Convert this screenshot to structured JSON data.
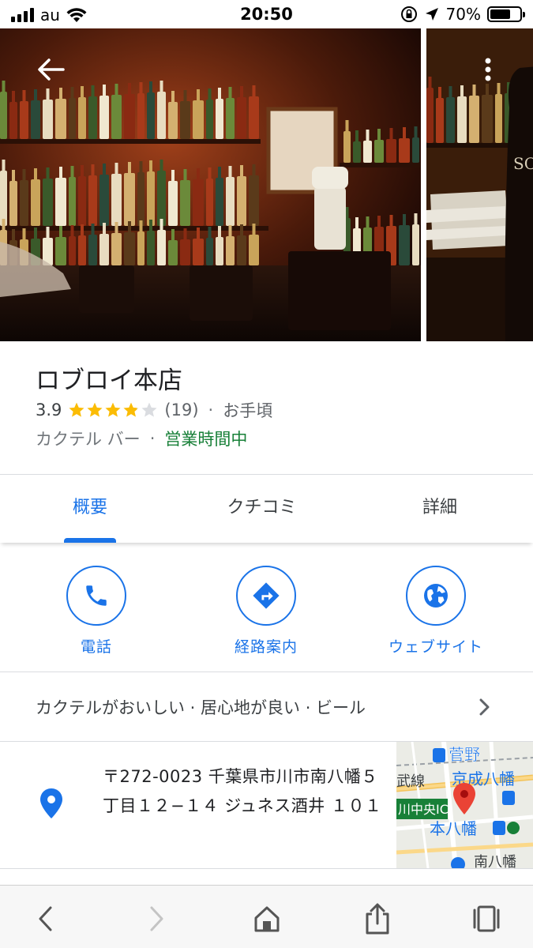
{
  "status_bar": {
    "carrier": "au",
    "time": "20:50",
    "battery": "70%",
    "battery_level": 0.7
  },
  "place": {
    "name": "ロブロイ本店",
    "rating": "3.9",
    "rating_value": 3.9,
    "review_count": "(19)",
    "separator": "·",
    "price_level": "お手頃",
    "category": "カクテル バー",
    "open_status": "営業時間中"
  },
  "tabs": [
    {
      "label": "概要",
      "active": true
    },
    {
      "label": "クチコミ",
      "active": false
    },
    {
      "label": "詳細",
      "active": false
    }
  ],
  "actions": {
    "call": "電話",
    "directions": "経路案内",
    "website": "ウェブサイト"
  },
  "highlights": "カクテルがおいしい · 居心地が良い · ビール",
  "address": "〒272-0023 千葉県市川市南八幡５丁目１２−１４ ジュネス酒井 １０１",
  "map": {
    "labels": [
      "菅野",
      "京成八幡",
      "武線",
      "川中央IC",
      "本八幡",
      "南八幡"
    ]
  },
  "colors": {
    "accent": "#1a73e8",
    "open": "#188038",
    "star": "#fbbc04",
    "pin": "#ea4335"
  },
  "icons": {
    "back": "arrow-left-icon",
    "more": "more-vert-icon",
    "call": "phone-icon",
    "directions": "directions-icon",
    "website": "globe-icon",
    "address": "location-pin-icon",
    "chevron": "chevron-right-icon",
    "toolbar": [
      "browser-back-icon",
      "browser-forward-icon",
      "home-icon",
      "share-icon",
      "tabs-icon"
    ]
  }
}
